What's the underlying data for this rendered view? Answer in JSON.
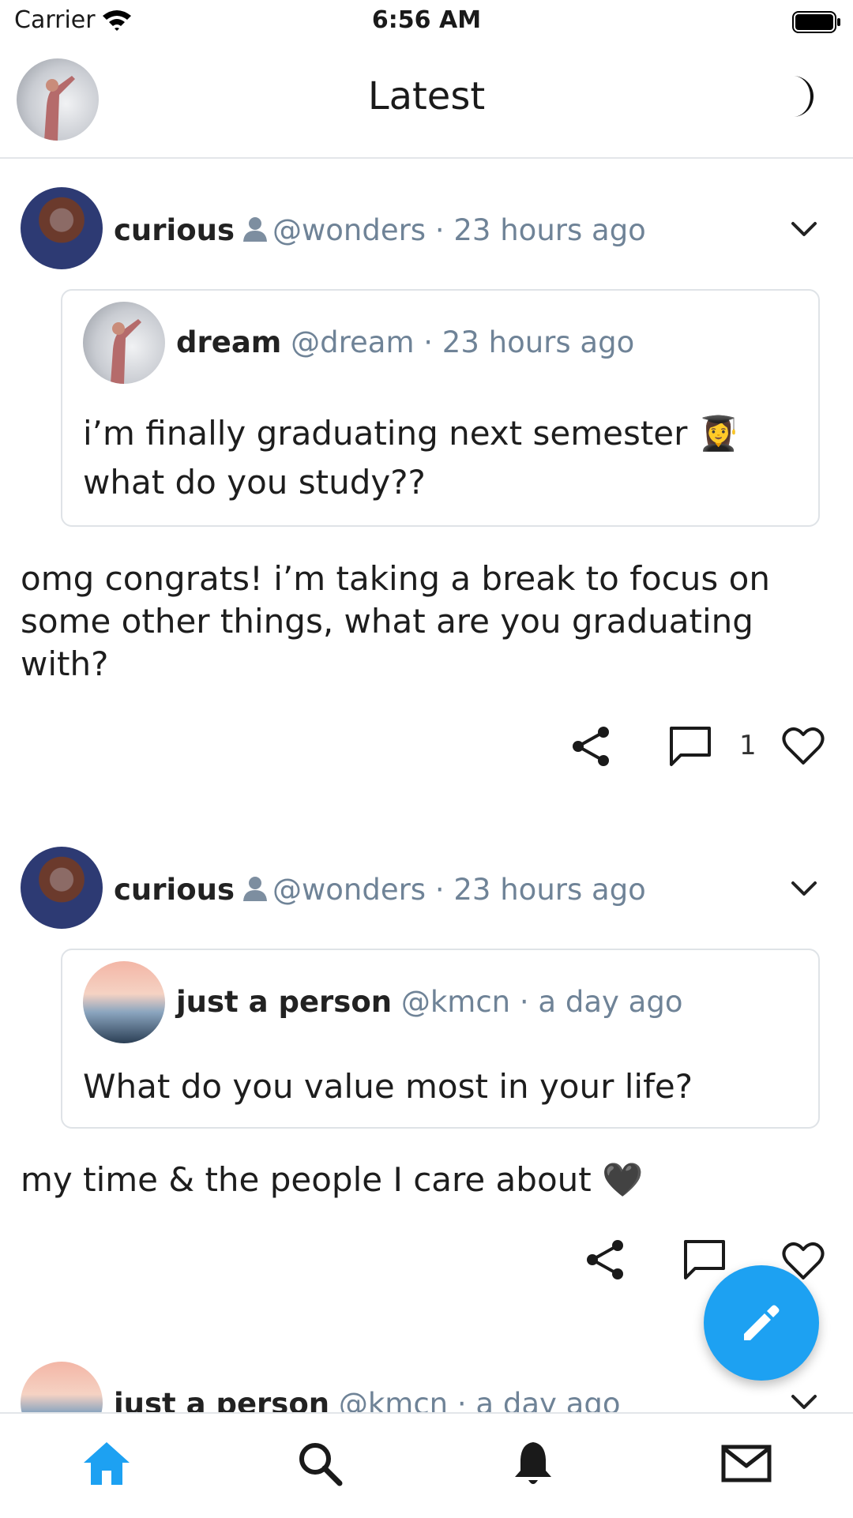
{
  "status_bar": {
    "carrier": "Carrier",
    "time": "6:56 AM"
  },
  "header": {
    "title": "Latest"
  },
  "posts": [
    {
      "name": "curious",
      "handle": "@wonders",
      "time": "23 hours ago",
      "quote": {
        "name": "dream",
        "handle": "@dream",
        "time": "23 hours ago",
        "text": "i’m finally graduating next semester 👩‍🎓 what do you study??"
      },
      "text": "omg congrats! i’m taking a break to focus on some other things, what are you graduating with?",
      "comment_count": "1"
    },
    {
      "name": "curious",
      "handle": "@wonders",
      "time": "23 hours ago",
      "quote": {
        "name": "just a person",
        "handle": "@kmcn",
        "time": "a day ago",
        "text": "What do you value most in your life?"
      },
      "text": "my time & the people I care about 🖤"
    },
    {
      "name": "just a person",
      "handle": "@kmcn",
      "time": "a day ago"
    }
  ],
  "separator": "·",
  "colors": {
    "accent": "#1da1f2",
    "muted": "#6f8397",
    "border": "#dfe3e7"
  },
  "tabs": [
    {
      "icon": "home-icon",
      "active": true
    },
    {
      "icon": "search-icon",
      "active": false
    },
    {
      "icon": "bell-icon",
      "active": false
    },
    {
      "icon": "mail-icon",
      "active": false
    }
  ]
}
